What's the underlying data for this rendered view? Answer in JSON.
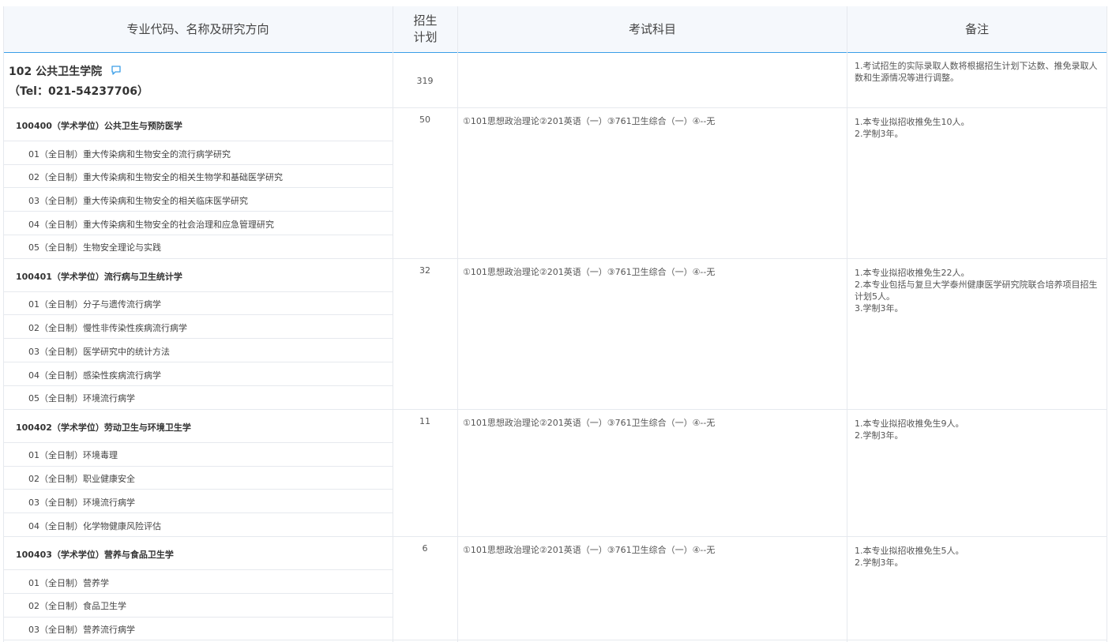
{
  "header": {
    "col_major": "专业代码、名称及研究方向",
    "col_plan": "招生\n计划",
    "col_exam": "考试科目",
    "col_note": "备注"
  },
  "college": {
    "name": "102 公共卫生学院",
    "tel": "（Tel：021-54237706）",
    "plan": "319",
    "note": "1.考试招生的实际录取人数将根据招生计划下达数、推免录取人数和生源情况等进行调整。"
  },
  "majors": [
    {
      "title": "100400（学术学位）公共卫生与预防医学",
      "plan": "50",
      "exam": "①101思想政治理论②201英语（一）③761卫生综合（一）④--无",
      "notes": [
        "1.本专业拟招收推免生10人。",
        "2.学制3年。"
      ],
      "directions": [
        "01（全日制）重大传染病和生物安全的流行病学研究",
        "02（全日制）重大传染病和生物安全的相关生物学和基础医学研究",
        "03（全日制）重大传染病和生物安全的相关临床医学研究",
        "04（全日制）重大传染病和生物安全的社会治理和应急管理研究",
        "05（全日制）生物安全理论与实践"
      ]
    },
    {
      "title": "100401（学术学位）流行病与卫生统计学",
      "plan": "32",
      "exam": "①101思想政治理论②201英语（一）③761卫生综合（一）④--无",
      "notes": [
        "1.本专业拟招收推免生22人。",
        "2.本专业包括与复旦大学泰州健康医学研究院联合培养项目招生计划5人。",
        "3.学制3年。"
      ],
      "directions": [
        "01（全日制）分子与遗传流行病学",
        "02（全日制）慢性非传染性疾病流行病学",
        "03（全日制）医学研究中的统计方法",
        "04（全日制）感染性疾病流行病学",
        "05（全日制）环境流行病学"
      ]
    },
    {
      "title": "100402（学术学位）劳动卫生与环境卫生学",
      "plan": "11",
      "exam": "①101思想政治理论②201英语（一）③761卫生综合（一）④--无",
      "notes": [
        "1.本专业拟招收推免生9人。",
        "2.学制3年。"
      ],
      "directions": [
        "01（全日制）环境毒理",
        "02（全日制）职业健康安全",
        "03（全日制）环境流行病学",
        "04（全日制）化学物健康风险评估"
      ]
    },
    {
      "title": "100403（学术学位）营养与食品卫生学",
      "plan": "6",
      "exam": "①101思想政治理论②201英语（一）③761卫生综合（一）④--无",
      "notes": [
        "1.本专业拟招收推免生5人。",
        "2.学制3年。"
      ],
      "directions": [
        "01（全日制）营养学",
        "02（全日制）食品卫生学",
        "03（全日制）营养流行病学"
      ]
    }
  ],
  "colors": {
    "header_bg": "#f5f8fc",
    "accent": "#3a9ee8",
    "border": "#e6e9ee"
  }
}
